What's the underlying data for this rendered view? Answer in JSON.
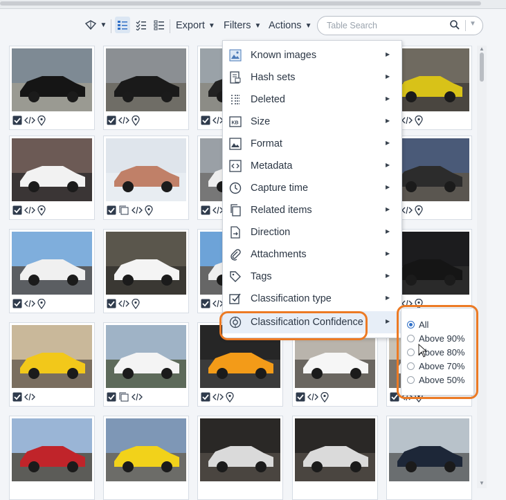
{
  "toolbar": {
    "export_label": "Export",
    "filters_label": "Filters",
    "actions_label": "Actions",
    "search_placeholder": "Table Search"
  },
  "menu": {
    "items": [
      {
        "label": "Known images",
        "icon": "known-images-icon"
      },
      {
        "label": "Hash sets",
        "icon": "hash-sets-icon"
      },
      {
        "label": "Deleted",
        "icon": "deleted-icon"
      },
      {
        "label": "Size",
        "icon": "size-kb-icon"
      },
      {
        "label": "Format",
        "icon": "format-icon"
      },
      {
        "label": "Metadata",
        "icon": "metadata-icon"
      },
      {
        "label": "Capture time",
        "icon": "clock-icon"
      },
      {
        "label": "Related items",
        "icon": "related-items-icon"
      },
      {
        "label": "Direction",
        "icon": "direction-icon"
      },
      {
        "label": "Attachments",
        "icon": "paperclip-icon"
      },
      {
        "label": "Tags",
        "icon": "tag-icon"
      },
      {
        "label": "Classification type",
        "icon": "classification-type-icon"
      },
      {
        "label": "Classification Confidence",
        "icon": "classification-confidence-icon"
      }
    ]
  },
  "submenu": {
    "options": [
      "All",
      "Above 90%",
      "Above 80%",
      "Above 70%",
      "Above 50%"
    ],
    "selected": "All"
  },
  "colors": {
    "highlight_ring": "#ec7a24",
    "accent": "#2f6fc7"
  }
}
